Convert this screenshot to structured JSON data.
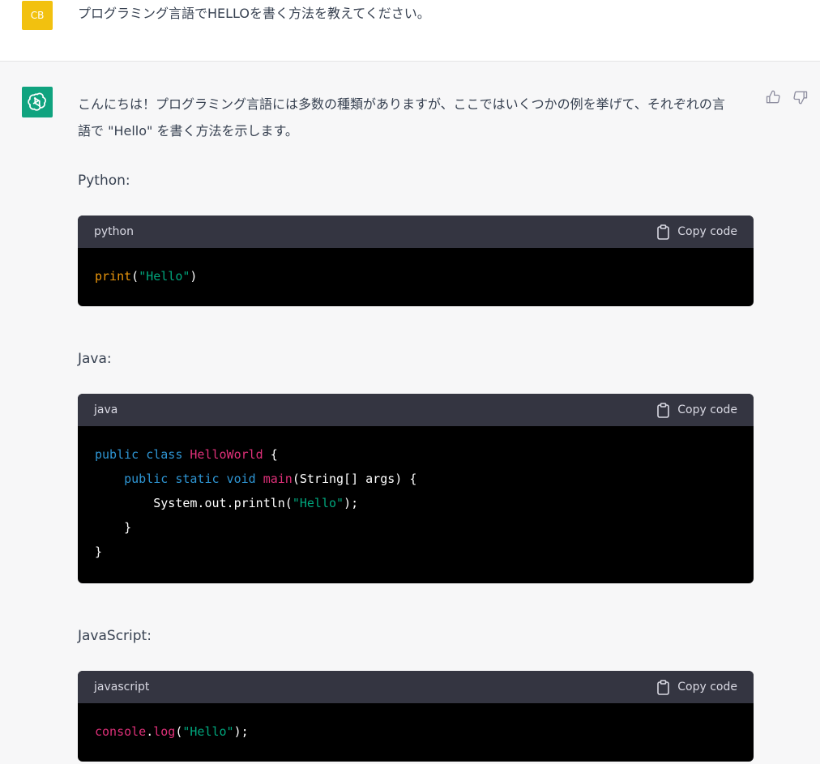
{
  "user_message": {
    "avatar_initials": "CB",
    "text": "プログラミング言語でHELLOを書く方法を教えてください。"
  },
  "assistant_message": {
    "avatar_icon": "openai-logo-icon",
    "intro_line1": "こんにちは！プログラミング言語には多数の種類がありますが、ここではいくつかの例を挙げて、それぞれの言",
    "intro_line2": "語で \"Hello\" を書く方法を示します。",
    "feedback": {
      "thumbs_up_icon": "thumbs-up-icon",
      "thumbs_down_icon": "thumbs-down-icon"
    }
  },
  "sections": [
    {
      "label": "Python:",
      "language": "python",
      "copy_label": "Copy code",
      "tokens": {
        "fn": "print",
        "open": "(",
        "str": "\"Hello\"",
        "close": ")"
      }
    },
    {
      "label": "Java:",
      "language": "java",
      "copy_label": "Copy code",
      "tokens": {
        "l1_kw": "public class ",
        "l1_cls": "HelloWorld",
        "l1_rest": " {",
        "l2_indent": "    ",
        "l2_kw": "public static void ",
        "l2_fn": "main",
        "l2_rest": "(String[] args) {",
        "l3_pre": "        System.out.println(",
        "l3_str": "\"Hello\"",
        "l3_post": ");",
        "l4": "    }",
        "l5": "}"
      }
    },
    {
      "label": "JavaScript:",
      "language": "javascript",
      "copy_label": "Copy code",
      "tokens": {
        "obj": "console",
        "dot": ".",
        "fn": "log",
        "open": "(",
        "str": "\"Hello\"",
        "close": ");"
      }
    }
  ],
  "colors": {
    "user_avatar": "#f2c10f",
    "assistant_avatar": "#10a37f",
    "code_header": "#343541",
    "code_body": "#000000",
    "string": "#00a67d",
    "keyword": "#2e95d3",
    "function": "#e9950c",
    "class": "#df3079"
  }
}
